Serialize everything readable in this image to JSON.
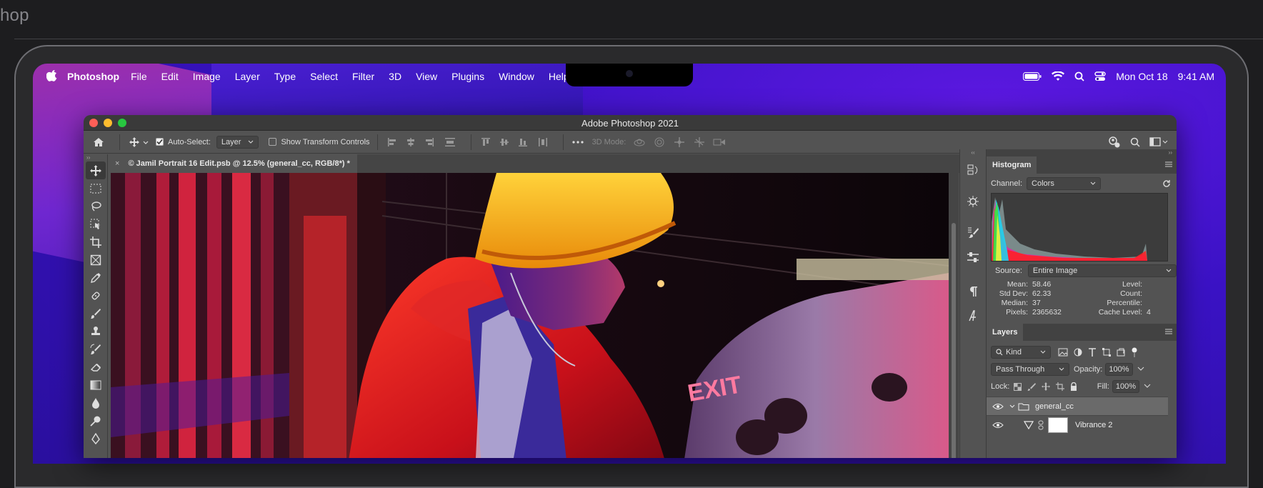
{
  "page": {
    "title_fragment": "hop"
  },
  "menubar": {
    "app_name": "Photoshop",
    "items": [
      "File",
      "Edit",
      "Image",
      "Layer",
      "Type",
      "Select",
      "Filter",
      "3D",
      "View",
      "Plugins",
      "Window",
      "Help"
    ],
    "date": "Mon Oct 18",
    "time": "9:41 AM"
  },
  "window": {
    "title": "Adobe Photoshop 2021"
  },
  "options_bar": {
    "auto_select_label": "Auto-Select:",
    "auto_select_value": "Layer",
    "transform_controls_label": "Show Transform Controls",
    "mode_3d_label": "3D Mode:"
  },
  "document": {
    "tab_title": "© Jamil Portrait 16 Edit.psb @ 12.5% (general_cc, RGB/8*) *"
  },
  "histogram": {
    "tab": "Histogram",
    "channel_label": "Channel:",
    "channel_value": "Colors",
    "source_label": "Source:",
    "source_value": "Entire Image",
    "stats": {
      "mean_label": "Mean:",
      "mean": "58.46",
      "stddev_label": "Std Dev:",
      "stddev": "62.33",
      "median_label": "Median:",
      "median": "37",
      "pixels_label": "Pixels:",
      "pixels": "2365632",
      "level_label": "Level:",
      "count_label": "Count:",
      "percentile_label": "Percentile:",
      "cache_label": "Cache Level:",
      "cache": "4"
    }
  },
  "layers": {
    "tab": "Layers",
    "kind_value": "Kind",
    "blend_mode": "Pass Through",
    "opacity_label": "Opacity:",
    "opacity": "100%",
    "lock_label": "Lock:",
    "fill_label": "Fill:",
    "fill": "100%",
    "rows": [
      {
        "name": "general_cc"
      },
      {
        "name": "Vibrance 2"
      }
    ]
  },
  "colors": {
    "accent": "#3a12c4",
    "close": "#ff5f57",
    "minimize": "#febc2e",
    "zoom": "#28c840"
  }
}
